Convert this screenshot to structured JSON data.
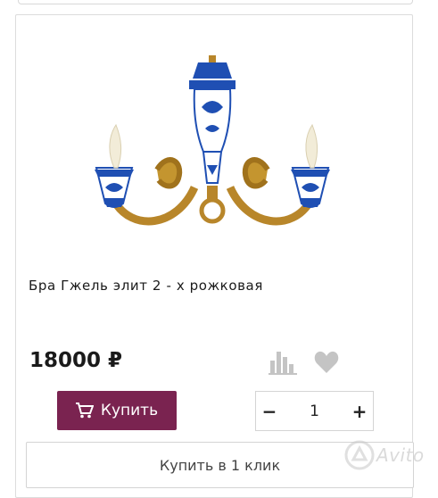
{
  "product": {
    "title": "Бра Гжель элит 2 - х рожковая",
    "price": "18000 ₽"
  },
  "actions": {
    "buy_label": "Купить",
    "quantity": "1",
    "minus": "−",
    "plus": "+",
    "one_click_label": "Купить в 1 клик"
  },
  "icons": {
    "cart": "cart-icon",
    "compare": "bar-chart-icon",
    "favorite": "heart-icon"
  },
  "watermark": {
    "text": "Avito"
  },
  "colors": {
    "buy_button": "#7a2350",
    "icon_gray": "#c4c4c4",
    "border": "#d4d4d4",
    "gzhel_blue": "#1f4fb3",
    "brass": "#b8862a"
  }
}
